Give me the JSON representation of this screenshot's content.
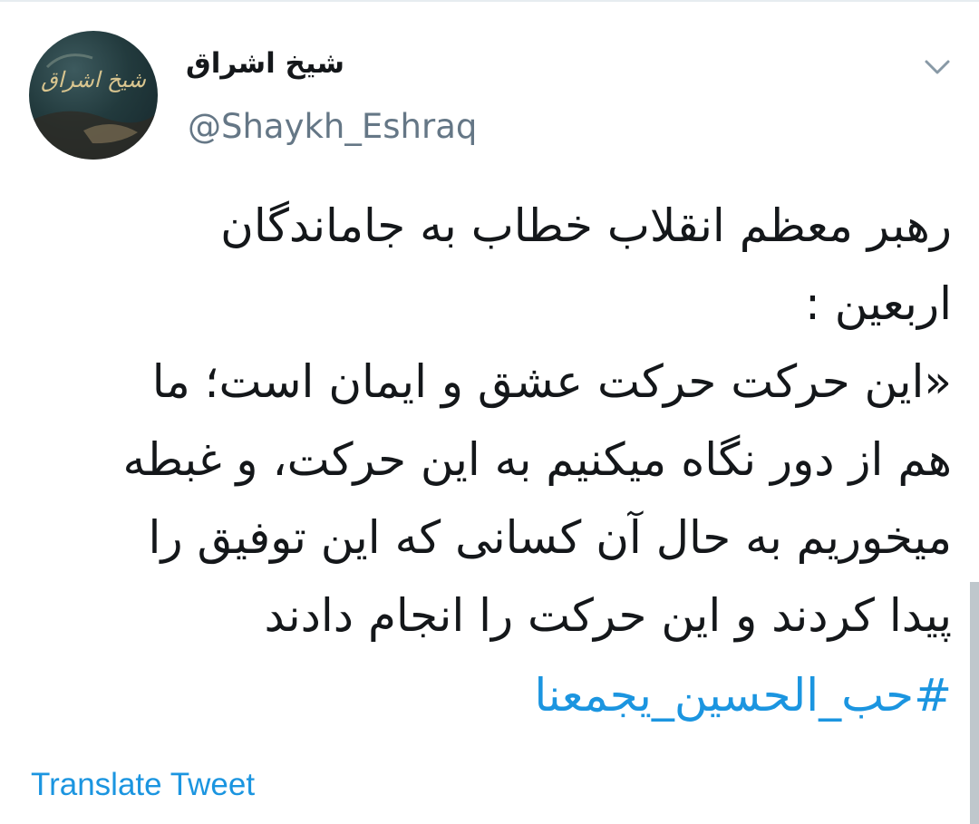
{
  "tweet": {
    "display_name": "شیخ اشراق",
    "handle": "@Shaykh_Eshraq",
    "avatar_text": "شیخ اشراق",
    "body_lines": [
      "رهبر معظم انقلاب خطاب به جاماندگان",
      "اربعین :",
      "«این حرکت حرکت عشق و ایمان است؛ ما",
      "هم از دور نگاه میکنیم به این حرکت، و غبطه",
      "میخوریم به حال آن کسانی که این توفیق را",
      "پیدا کردند و این حرکت را انجام دادند"
    ],
    "hashtag": "#حب_الحسین_یجمعنا",
    "translate_label": "Translate Tweet",
    "menu_icon": "chevron-down-icon"
  },
  "colors": {
    "link": "#1b95e0",
    "handle": "#657786",
    "text": "#14171a"
  }
}
